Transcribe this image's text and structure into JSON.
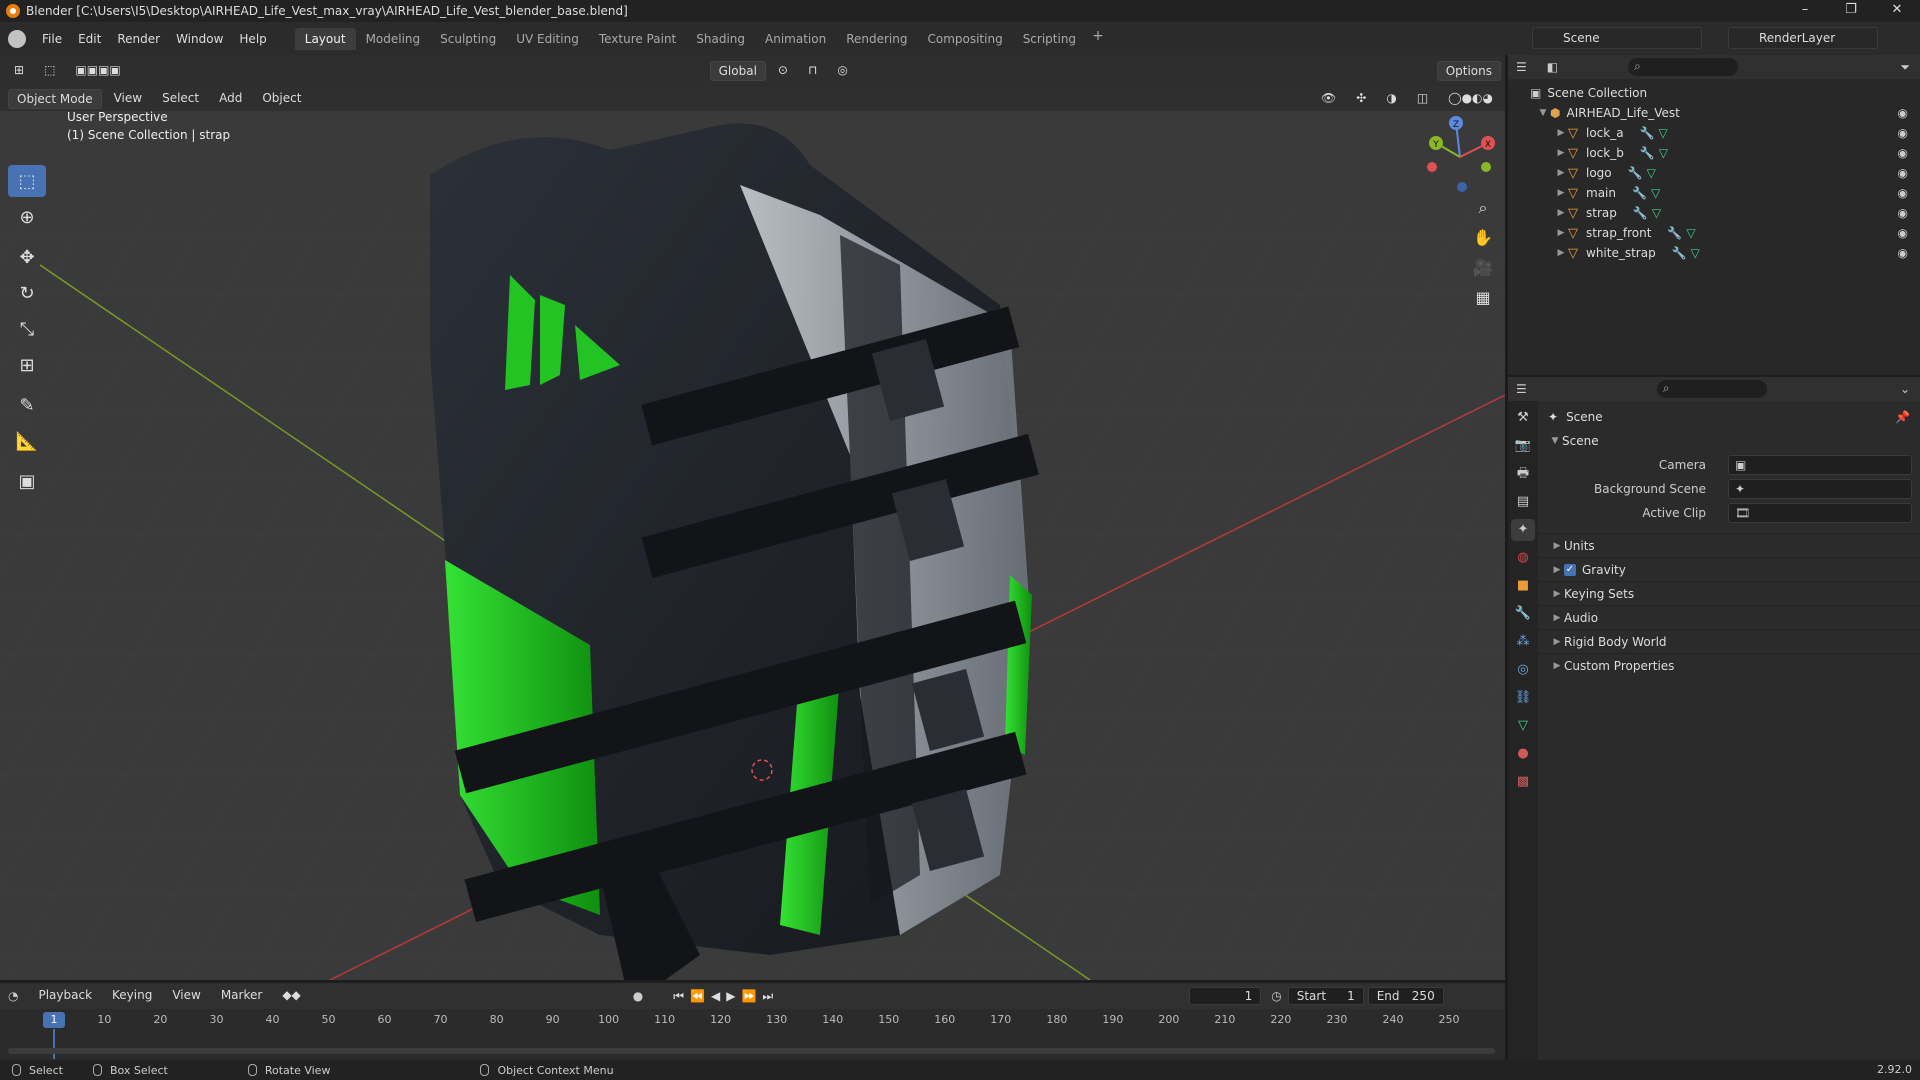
{
  "titlebar": {
    "title": "Blender [C:\\Users\\I5\\Desktop\\AIRHEAD_Life_Vest_max_vray\\AIRHEAD_Life_Vest_blender_base.blend]",
    "minimize": "–",
    "maximize": "❐",
    "close": "✕"
  },
  "menu": {
    "file": "File",
    "edit": "Edit",
    "render": "Render",
    "window": "Window",
    "help": "Help"
  },
  "workspaces": [
    "Layout",
    "Modeling",
    "Sculpting",
    "UV Editing",
    "Texture Paint",
    "Shading",
    "Animation",
    "Rendering",
    "Compositing",
    "Scripting"
  ],
  "workspace_add": "+",
  "scene": {
    "name": "Scene",
    "render_layer": "RenderLayer"
  },
  "viewport": {
    "mode": "Object Mode",
    "menus": [
      "View",
      "Select",
      "Add",
      "Object"
    ],
    "transform_orientation": "Global",
    "options": "Options",
    "perspective": "User Perspective",
    "collection_info": "(1) Scene Collection | strap",
    "gizmo": {
      "x": "X",
      "y": "Y",
      "z": "Z"
    }
  },
  "outliner": {
    "root": "Scene Collection",
    "collection": "AIRHEAD_Life_Vest",
    "objects": [
      "lock_a",
      "lock_b",
      "logo",
      "main",
      "strap",
      "strap_front",
      "white_strap"
    ]
  },
  "properties": {
    "header": "Scene",
    "panel": "Scene",
    "camera_label": "Camera",
    "bg_scene_label": "Background Scene",
    "active_clip_label": "Active Clip",
    "panels": [
      "Units",
      "Gravity",
      "Keying Sets",
      "Audio",
      "Rigid Body World",
      "Custom Properties"
    ]
  },
  "timeline": {
    "playback": "Playback",
    "keying": "Keying",
    "view": "View",
    "marker": "Marker",
    "current_frame": "1",
    "start_label": "Start",
    "start": "1",
    "end_label": "End",
    "end": "250",
    "ticks": [
      "1",
      "10",
      "20",
      "30",
      "40",
      "50",
      "60",
      "70",
      "80",
      "90",
      "100",
      "110",
      "120",
      "130",
      "140",
      "150",
      "160",
      "170",
      "180",
      "190",
      "200",
      "210",
      "220",
      "230",
      "240",
      "250"
    ]
  },
  "status": {
    "select": "Select",
    "box_select": "Box Select",
    "rotate_view": "Rotate View",
    "context_menu": "Object Context Menu",
    "version": "2.92.0"
  },
  "colors": {
    "accent": "#4772b3",
    "vest_green": "#1fd11f",
    "vest_dark": "#1b1f26",
    "vest_grey": "#9aa0a8"
  }
}
